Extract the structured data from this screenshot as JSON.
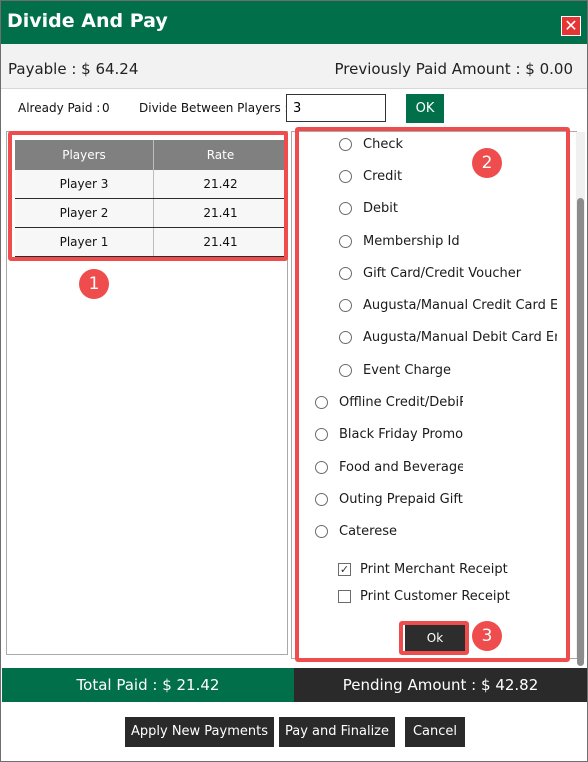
{
  "window": {
    "title": "Divide And Pay",
    "close_glyph": "✕"
  },
  "summary": {
    "payable": "Payable : $ 64.24",
    "previously_paid": "Previously Paid Amount : $ 0.00"
  },
  "controls": {
    "already_paid_label": "Already Paid :",
    "already_paid_value": "0",
    "divide_label": "Divide Between Players :",
    "divide_value": "3",
    "ok_label": "OK"
  },
  "players_table": {
    "headers": [
      "Players",
      "Rate"
    ],
    "rows": [
      {
        "player": "Player 3",
        "rate": "21.42"
      },
      {
        "player": "Player 2",
        "rate": "21.41"
      },
      {
        "player": "Player 1",
        "rate": "21.41"
      }
    ]
  },
  "payment_methods": {
    "options": [
      "Check",
      "Credit",
      "Debit",
      "Membership Id",
      "Gift Card/Credit Voucher",
      "Augusta/Manual Credit Card Entry",
      "Augusta/Manual Debit Card Entry",
      "Event Charge",
      "Offline Credit/DebiRe",
      "Black Friday Promo",
      "Food and Beverage C",
      "Outing Prepaid Gift C",
      "Caterese"
    ],
    "receipts": [
      {
        "label": "Print Merchant Receipt",
        "checked": true
      },
      {
        "label": "Print Customer Receipt",
        "checked": false
      }
    ],
    "ok_label": "Ok"
  },
  "callouts": [
    "1",
    "2",
    "3"
  ],
  "totals": {
    "total_paid": "Total Paid : $ 21.42",
    "pending": "Pending Amount : $ 42.82"
  },
  "actions": {
    "apply": "Apply New Payments",
    "pay_finalize": "Pay and Finalize",
    "cancel": "Cancel"
  },
  "colors": {
    "brand_green": "#01704a",
    "dark": "#2a2a2a",
    "callout_red": "#ef4d4d"
  }
}
